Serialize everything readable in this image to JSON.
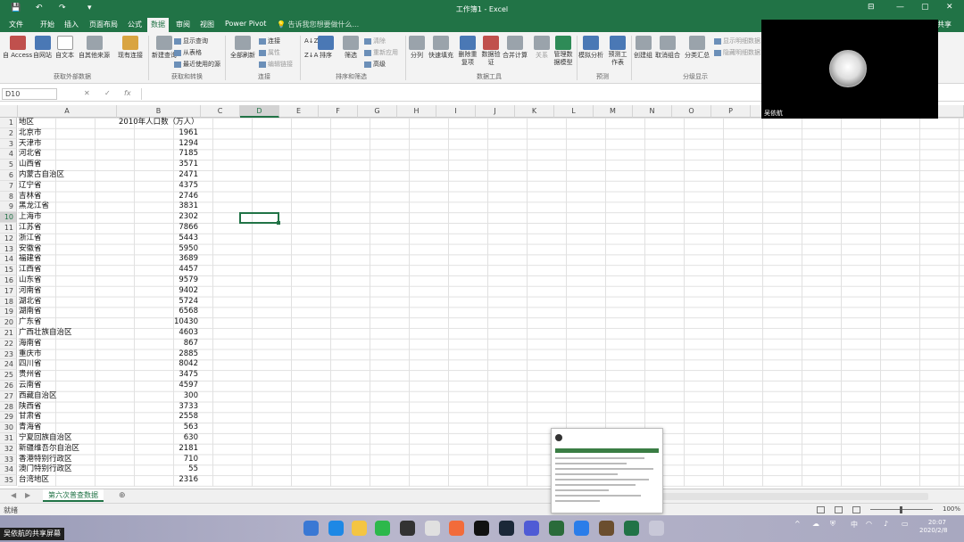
{
  "window": {
    "title": "工作簿1 - Excel",
    "share": "共享"
  },
  "qat": {
    "save": "💾",
    "undo": "↶",
    "redo": "↷",
    "more": "▾"
  },
  "winctrl": {
    "minimize": "—",
    "restore": "▢",
    "close": "✕",
    "ribbon_opts": "⊟"
  },
  "tabs": [
    "文件",
    "开始",
    "插入",
    "页面布局",
    "公式",
    "数据",
    "审阅",
    "视图",
    "Power Pivot"
  ],
  "active_tab": "数据",
  "tell_me": "告诉我您想要做什么...",
  "ribbon": {
    "get_external": {
      "label": "获取外部数据",
      "items": [
        "自 Access",
        "自网站",
        "自文本",
        "自其他来源",
        "现有连接"
      ]
    },
    "get_transform": {
      "label": "获取和转换",
      "new_query": "新建查询",
      "small": [
        "显示查询",
        "从表格",
        "最近使用的源"
      ]
    },
    "connections": {
      "label": "连接",
      "refresh_all": "全部刷新",
      "small": [
        "连接",
        "属性",
        "编辑链接"
      ]
    },
    "sort_filter": {
      "label": "排序和筛选",
      "sort": "排序",
      "filter": "筛选",
      "small": [
        "清除",
        "重新应用",
        "高级"
      ]
    },
    "data_tools": {
      "label": "数据工具",
      "items": [
        "分列",
        "快速填充",
        "删除重复项",
        "数据验证",
        "合并计算",
        "关系",
        "管理数据模型"
      ]
    },
    "forecast": {
      "label": "预测",
      "items": [
        "模拟分析",
        "预测工作表"
      ]
    },
    "outline": {
      "label": "分级显示",
      "items": [
        "创建组",
        "取消组合",
        "分类汇总"
      ],
      "small": [
        "显示明细数据",
        "隐藏明细数据"
      ]
    }
  },
  "formula_bar": {
    "name_box": "D10",
    "cancel": "✕",
    "enter": "✓",
    "fx": "fx",
    "value": ""
  },
  "columns": [
    "A",
    "B",
    "C",
    "D",
    "E",
    "F",
    "G",
    "H",
    "I",
    "J",
    "K",
    "L",
    "M",
    "N",
    "O",
    "P"
  ],
  "selected_column": "D",
  "selected_row": 10,
  "sheet": {
    "header": {
      "a": "地区",
      "b": "2010年人口数（万人）"
    },
    "rows": [
      {
        "region": "北京市",
        "pop": "1961"
      },
      {
        "region": "天津市",
        "pop": "1294"
      },
      {
        "region": "河北省",
        "pop": "7185"
      },
      {
        "region": "山西省",
        "pop": "3571"
      },
      {
        "region": "内蒙古自治区",
        "pop": "2471"
      },
      {
        "region": "辽宁省",
        "pop": "4375"
      },
      {
        "region": "吉林省",
        "pop": "2746"
      },
      {
        "region": "黑龙江省",
        "pop": "3831"
      },
      {
        "region": "上海市",
        "pop": "2302"
      },
      {
        "region": "江苏省",
        "pop": "7866"
      },
      {
        "region": "浙江省",
        "pop": "5443"
      },
      {
        "region": "安徽省",
        "pop": "5950"
      },
      {
        "region": "福建省",
        "pop": "3689"
      },
      {
        "region": "江西省",
        "pop": "4457"
      },
      {
        "region": "山东省",
        "pop": "9579"
      },
      {
        "region": "河南省",
        "pop": "9402"
      },
      {
        "region": "湖北省",
        "pop": "5724"
      },
      {
        "region": "湖南省",
        "pop": "6568"
      },
      {
        "region": "广东省",
        "pop": "10430"
      },
      {
        "region": "广西壮族自治区",
        "pop": "4603"
      },
      {
        "region": "海南省",
        "pop": "867"
      },
      {
        "region": "重庆市",
        "pop": "2885"
      },
      {
        "region": "四川省",
        "pop": "8042"
      },
      {
        "region": "贵州省",
        "pop": "3475"
      },
      {
        "region": "云南省",
        "pop": "4597"
      },
      {
        "region": "西藏自治区",
        "pop": "300"
      },
      {
        "region": "陕西省",
        "pop": "3733"
      },
      {
        "region": "甘肃省",
        "pop": "2558"
      },
      {
        "region": "青海省",
        "pop": "563"
      },
      {
        "region": "宁夏回族自治区",
        "pop": "630"
      },
      {
        "region": "新疆维吾尔自治区",
        "pop": "2181"
      },
      {
        "region": "香港特别行政区",
        "pop": "710"
      },
      {
        "region": "澳门特别行政区",
        "pop": "55"
      },
      {
        "region": "台湾地区",
        "pop": "2316"
      }
    ]
  },
  "sheet_tab": "第六次普查数据",
  "add_sheet": "⊕",
  "status": {
    "ready": "就绪",
    "zoom": "100%"
  },
  "video": {
    "name": "吴依航"
  },
  "taskbar": {
    "share_label": "吴依航的共享屏幕",
    "time": "20:07",
    "date": "2020/2/8",
    "ime": "中",
    "tray_up": "^"
  }
}
